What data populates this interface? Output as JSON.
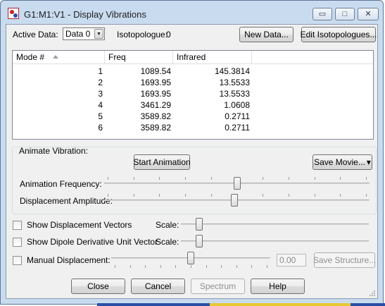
{
  "window": {
    "title": "G1:M1:V1 - Display Vibrations",
    "minimize_glyph": "▭",
    "maximize_glyph": "□",
    "close_glyph": "✕"
  },
  "toolbar": {
    "active_data_label": "Active Data:",
    "active_data_value": "Data 0",
    "isotopologue_label": "Isotopologue:",
    "isotopologue_value": "0",
    "new_data_button": "New Data...",
    "edit_isotopologues_button": "Edit Isotopologues..."
  },
  "table": {
    "headers": [
      "Mode #",
      "Freq",
      "Infrared"
    ],
    "rows": [
      {
        "mode": "1",
        "freq": "1089.54",
        "infrared": "145.3814"
      },
      {
        "mode": "2",
        "freq": "1693.95",
        "infrared": "13.5533"
      },
      {
        "mode": "3",
        "freq": "1693.95",
        "infrared": "13.5533"
      },
      {
        "mode": "4",
        "freq": "3461.29",
        "infrared": "1.0608"
      },
      {
        "mode": "5",
        "freq": "3589.82",
        "infrared": "0.2711"
      },
      {
        "mode": "6",
        "freq": "3589.82",
        "infrared": "0.2711"
      }
    ]
  },
  "animate": {
    "group_label": "Animate Vibration:",
    "start_button": "Start Animation",
    "save_movie_button": "Save Movie...",
    "save_movie_arrow": "▾",
    "frequency_label": "Animation Frequency:",
    "frequency_level": 0.5,
    "amplitude_label": "Displacement Amplitude:",
    "amplitude_level": 0.49
  },
  "options": {
    "show_vectors_label": "Show Displacement Vectors",
    "show_vectors_checked": false,
    "vectors_scale_label": "Scale:",
    "vectors_scale_level": 0.08,
    "show_dipole_label": "Show Dipole Derivative Unit Vector",
    "show_dipole_checked": false,
    "dipole_scale_label": "Scale:",
    "dipole_scale_level": 0.08,
    "manual_label": "Manual Displacement:",
    "manual_checked": false,
    "manual_level": 0.5,
    "manual_value": "0.00",
    "save_structure_button": "Save Structure..."
  },
  "footer": {
    "close_button": "Close",
    "cancel_button": "Cancel",
    "spectrum_button": "Spectrum",
    "help_button": "Help"
  },
  "colors": {
    "frame": "#c9dbee",
    "client": "#f0f0f0",
    "list_background": "#ffffff"
  }
}
